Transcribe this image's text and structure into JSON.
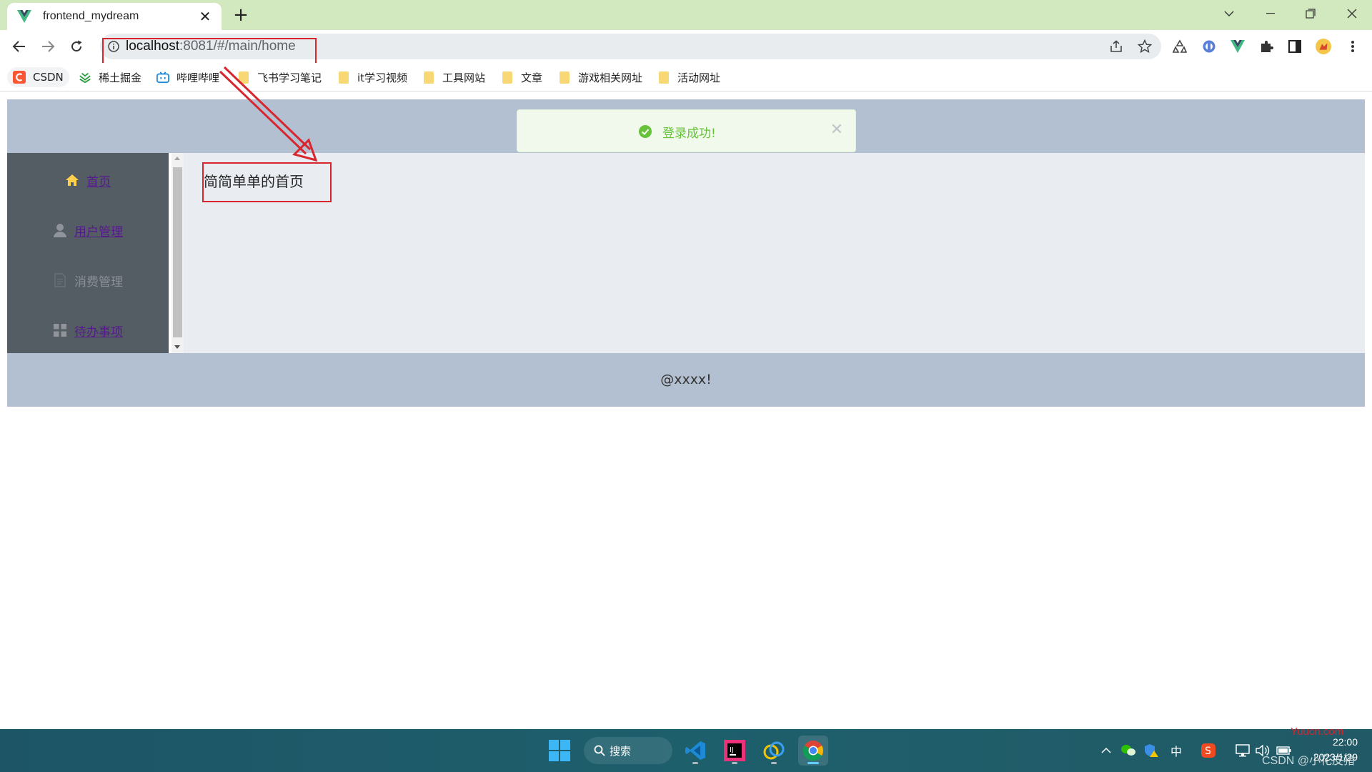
{
  "browser": {
    "tab_title": "frontend_mydream",
    "tab_close": "✕",
    "new_tab": "+",
    "url_host": "localhost",
    "url_rest": ":8081/#/main/home",
    "bookmarks": [
      {
        "label": "CSDN",
        "icon": "csdn-icon"
      },
      {
        "label": "稀土掘金",
        "icon": "juejin-icon"
      },
      {
        "label": "哔哩哔哩",
        "icon": "bilibili-icon"
      },
      {
        "label": "飞书学习笔记",
        "icon": "folder-icon"
      },
      {
        "label": "it学习视频",
        "icon": "folder-icon"
      },
      {
        "label": "工具网站",
        "icon": "folder-icon"
      },
      {
        "label": "文章",
        "icon": "folder-icon"
      },
      {
        "label": "游戏相关网址",
        "icon": "folder-icon"
      },
      {
        "label": "活动网址",
        "icon": "folder-icon"
      }
    ]
  },
  "app": {
    "menu": [
      {
        "label": "首页",
        "icon": "home-icon",
        "style": "link-active"
      },
      {
        "label": "用户管理",
        "icon": "user-icon",
        "style": "link"
      },
      {
        "label": "消费管理",
        "icon": "document-icon",
        "style": "plain"
      },
      {
        "label": "待办事项",
        "icon": "grid-icon",
        "style": "link"
      }
    ],
    "main_text": "简简单单的首页",
    "footer_text": "@xxxx!",
    "toast": {
      "message": "登录成功!",
      "close": "✕"
    }
  },
  "taskbar": {
    "search_label": "搜索",
    "ime": "中",
    "time": "22:00",
    "date": "2023/1/29",
    "watermark_1": "Yuucn.com",
    "watermark_2": "CSDN @小花皮猪"
  },
  "colors": {
    "tab_strip": "#d2e8bf",
    "header": "#b3c0d1",
    "aside": "#545c64",
    "main": "#e9edf1",
    "toast_bg": "#f0f9eb",
    "toast_text": "#67c23a",
    "annotation": "#d8262f"
  }
}
